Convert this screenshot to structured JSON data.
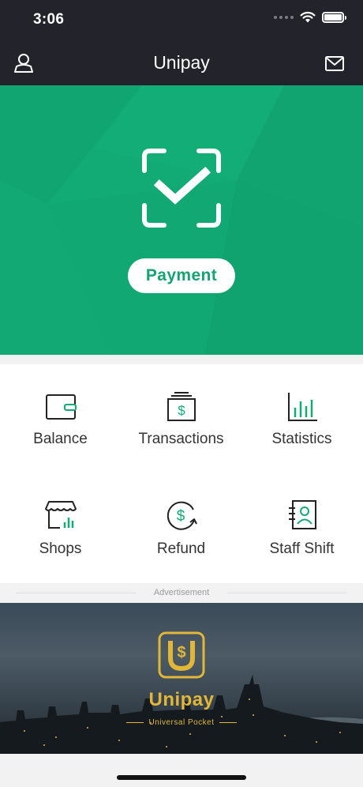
{
  "status_bar": {
    "time": "3:06"
  },
  "header": {
    "title": "Unipay"
  },
  "hero": {
    "payment_label": "Payment"
  },
  "menu": {
    "balance": "Balance",
    "transactions": "Transactions",
    "statistics": "Statistics",
    "shops": "Shops",
    "refund": "Refund",
    "staff_shift": "Staff Shift"
  },
  "ad": {
    "section_label": "Advertisement",
    "brand": "Unipay",
    "tagline": "Universal Pocket"
  },
  "colors": {
    "brand_green": "#12ab75",
    "header_dark": "#23232b",
    "gold": "#e2b737"
  }
}
